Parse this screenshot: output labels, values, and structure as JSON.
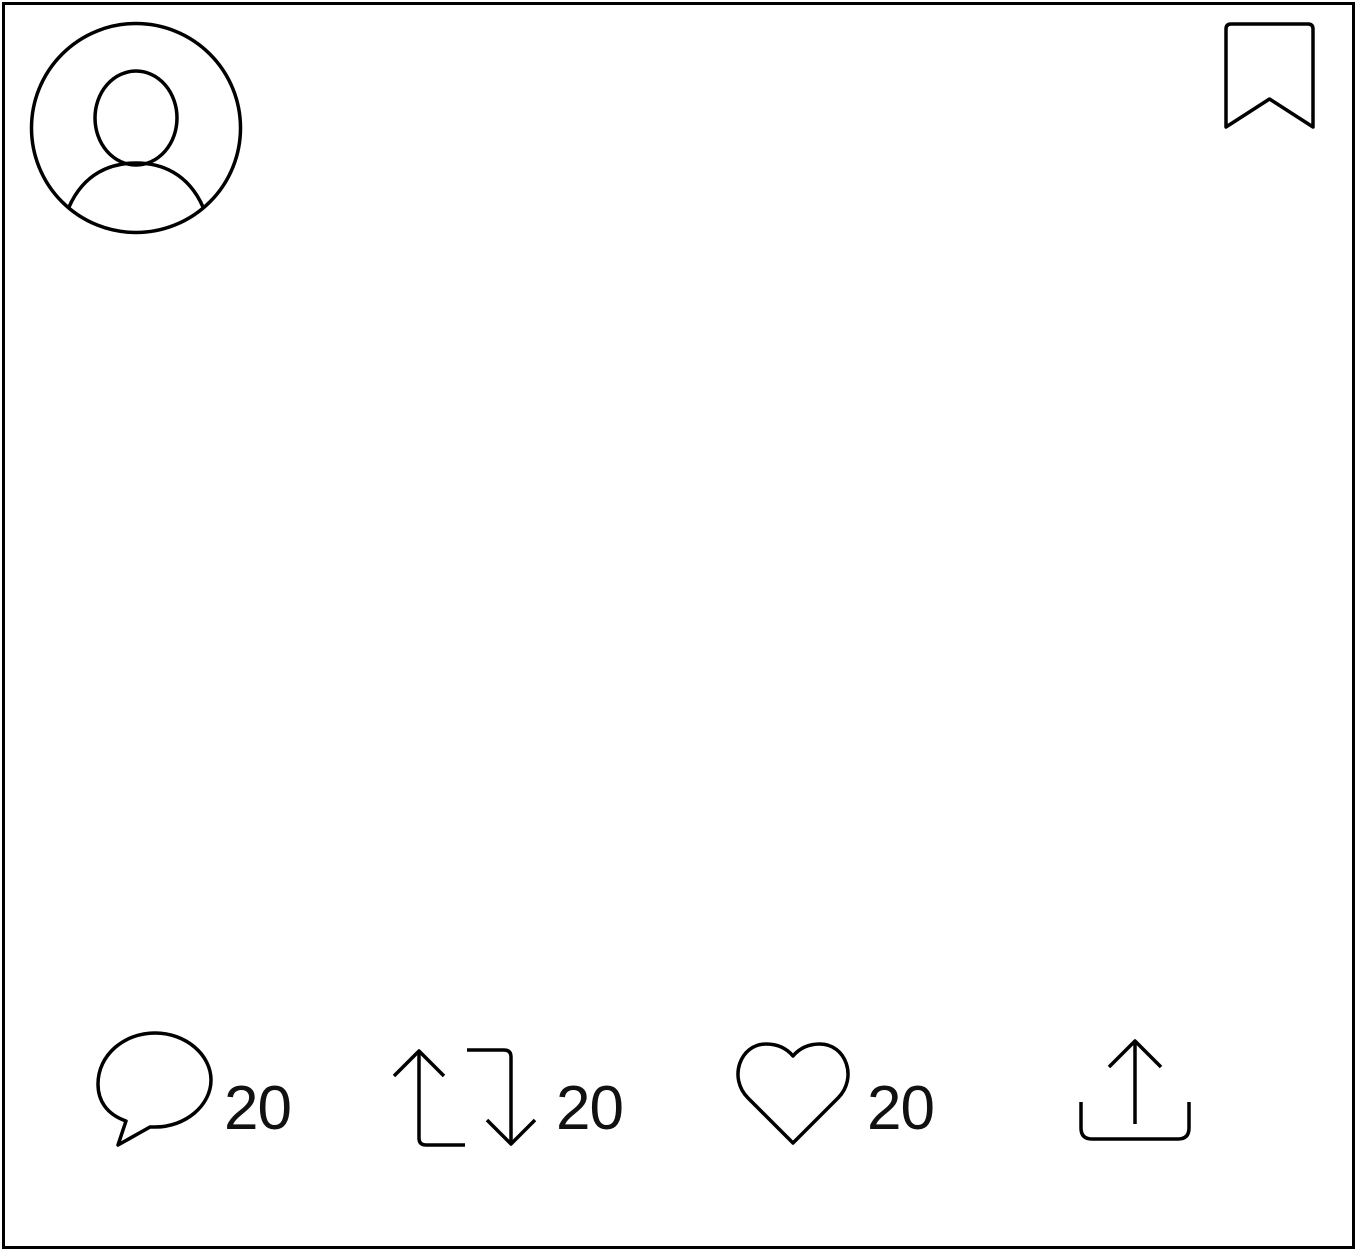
{
  "post": {
    "actions": {
      "comment": {
        "icon": "speech-bubble-icon",
        "count": "20"
      },
      "repost": {
        "icon": "repost-arrows-icon",
        "count": "20"
      },
      "like": {
        "icon": "heart-icon",
        "count": "20"
      },
      "share": {
        "icon": "upload-share-icon"
      }
    },
    "header": {
      "avatar_icon": "user-avatar-icon",
      "bookmark_icon": "bookmark-icon"
    }
  }
}
